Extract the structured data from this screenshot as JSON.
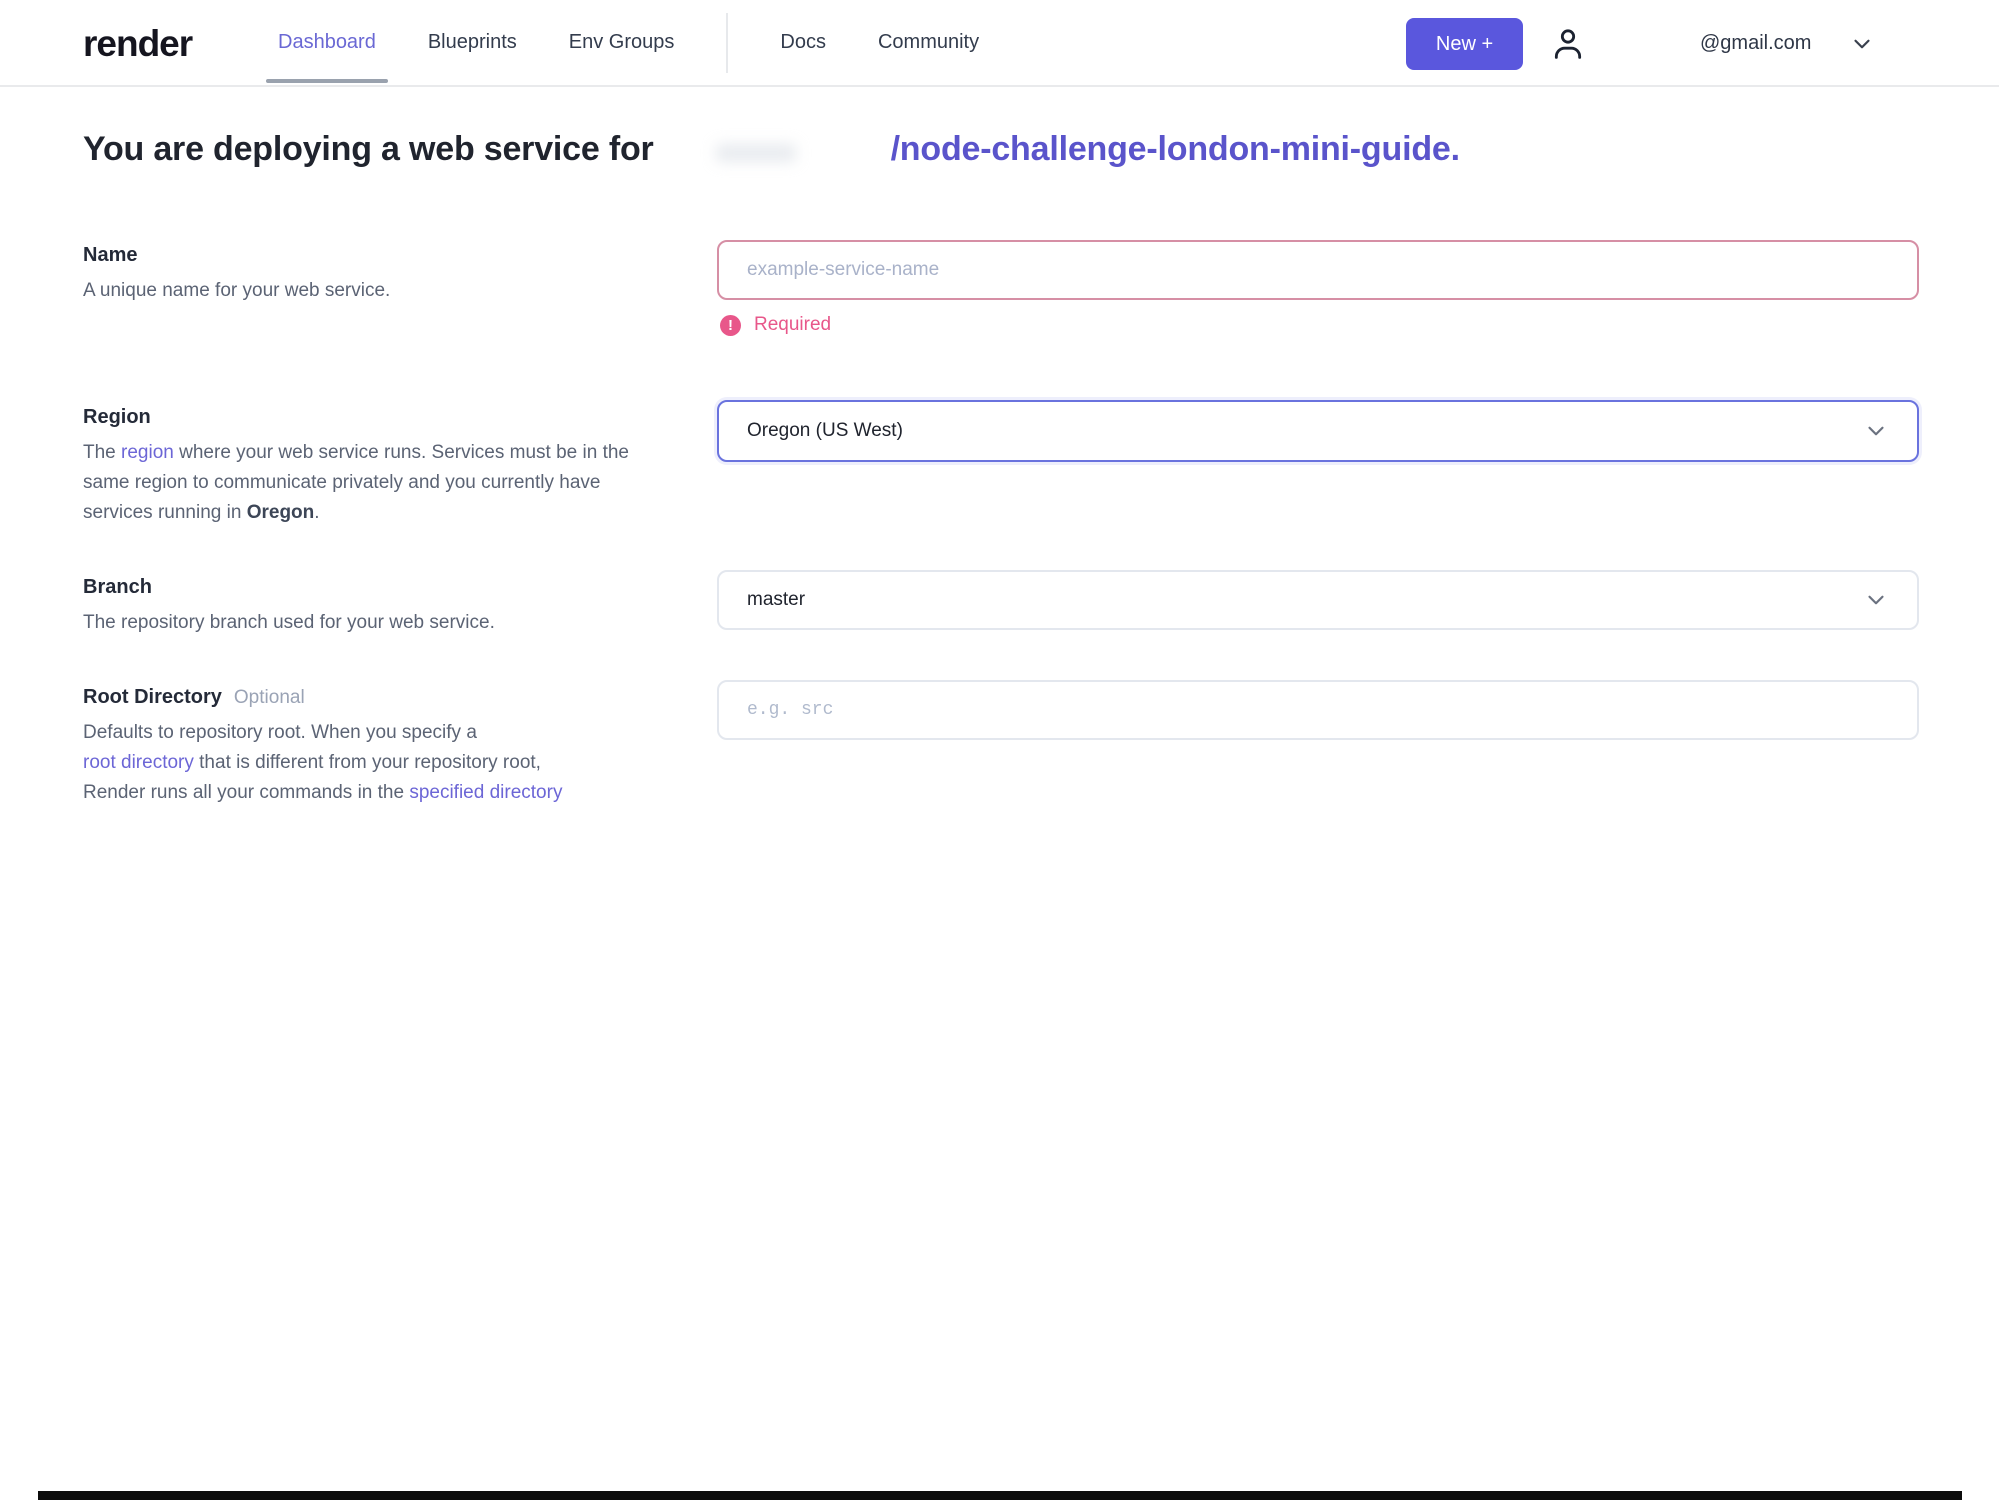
{
  "nav": {
    "logo": "render",
    "items": [
      {
        "label": "Dashboard",
        "active": true
      },
      {
        "label": "Blueprints",
        "active": false
      },
      {
        "label": "Env Groups",
        "active": false
      },
      {
        "label": "Docs",
        "active": false
      },
      {
        "label": "Community",
        "active": false
      }
    ],
    "new_button_label": "New +",
    "account_email": "@gmail.com"
  },
  "heading": {
    "prefix": "You are deploying a web service for",
    "repo_link": "/node-challenge-london-mini-guide."
  },
  "form": {
    "name": {
      "label": "Name",
      "description": "A unique name for your web service.",
      "placeholder": "example-service-name",
      "error_icon_glyph": "!",
      "error": "Required"
    },
    "region": {
      "label": "Region",
      "desc_pre": "The ",
      "desc_link": "region",
      "desc_mid": " where your web service runs. Services must be in the same region to communicate privately and you currently have services running in ",
      "desc_bold": "Oregon",
      "desc_end": ".",
      "value": "Oregon (US West)"
    },
    "branch": {
      "label": "Branch",
      "description": "The repository branch used for your web service.",
      "value": "master"
    },
    "root_directory": {
      "label": "Root Directory",
      "optional_tag": "Optional",
      "desc_line1": "Defaults to repository root. When you specify a",
      "desc_line2_link": "root directory",
      "desc_line2_rest": " that is different from your repository root,",
      "desc_line3_pre": "Render runs all your commands in the ",
      "desc_line3_link": "specified directory",
      "placeholder": "e.g. src"
    }
  },
  "icons": {
    "account_user": "user-icon",
    "account_chevron": "chevron-down-icon",
    "region_chevron": "chevron-down-icon",
    "branch_chevron": "chevron-down-icon",
    "name_error": "alert-circle-icon"
  },
  "colors": {
    "accent_purple": "#5a57dd",
    "active_nav_purple": "#6a68d4",
    "heading_link_purple": "#5a54cb",
    "error_pink": "#e8578a",
    "error_border_pink": "#d68fa5",
    "focus_border_indigo": "#6a73de"
  }
}
